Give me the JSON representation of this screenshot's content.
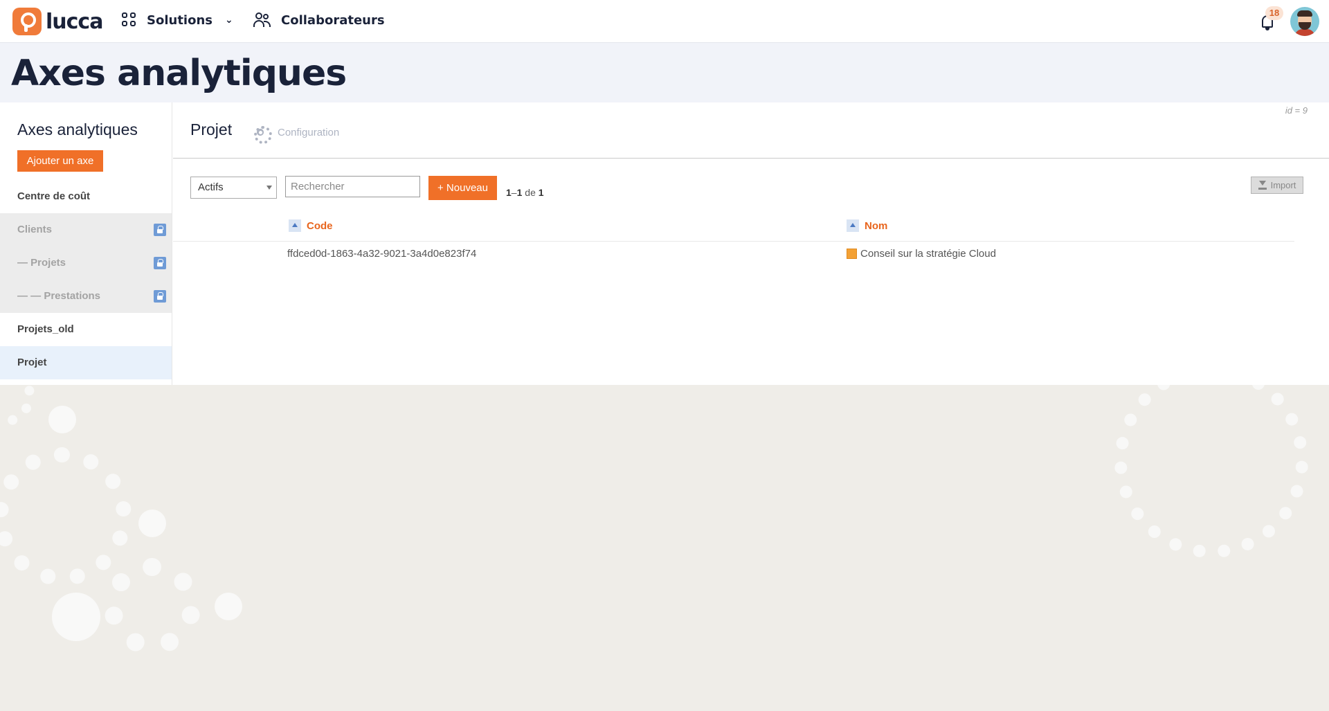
{
  "header": {
    "logo_text": "lucca",
    "nav": {
      "solutions_label": "Solutions",
      "collaborateurs_label": "Collaborateurs"
    },
    "notifications_count": "18"
  },
  "page": {
    "title": "Axes analytiques"
  },
  "sidebar": {
    "title": "Axes analytiques",
    "add_button": "Ajouter un axe",
    "items": [
      {
        "label": "Centre de coût",
        "state": "normal"
      },
      {
        "label": "Clients",
        "state": "locked"
      },
      {
        "label": "— Projets",
        "state": "locked"
      },
      {
        "label": "— — Prestations",
        "state": "locked"
      },
      {
        "label": "Projets_old",
        "state": "normal"
      },
      {
        "label": "Projet",
        "state": "active"
      }
    ]
  },
  "main": {
    "id_label": "id = 9",
    "title": "Projet",
    "configuration_label": "Configuration",
    "filter": {
      "selected": "Actifs"
    },
    "search": {
      "placeholder": "Rechercher"
    },
    "new_button": "+ Nouveau",
    "pager": {
      "from": "1",
      "to": "1",
      "of_word": "de",
      "total": "1"
    },
    "import_button": "Import",
    "table": {
      "columns": [
        "Code",
        "Nom"
      ],
      "rows": [
        {
          "code": "ffdced0d-1863-4a32-9021-3a4d0e823f74",
          "nom": "Conseil sur la stratégie Cloud"
        }
      ]
    }
  },
  "colors": {
    "accent": "#f07028",
    "brand": "#f07b3a",
    "title_text": "#1a2239"
  },
  "icons": [
    "grid-icon",
    "chevron-down-icon",
    "people-icon",
    "bell-icon",
    "lock-icon",
    "gear-icon",
    "download-icon",
    "sort-up-icon"
  ]
}
